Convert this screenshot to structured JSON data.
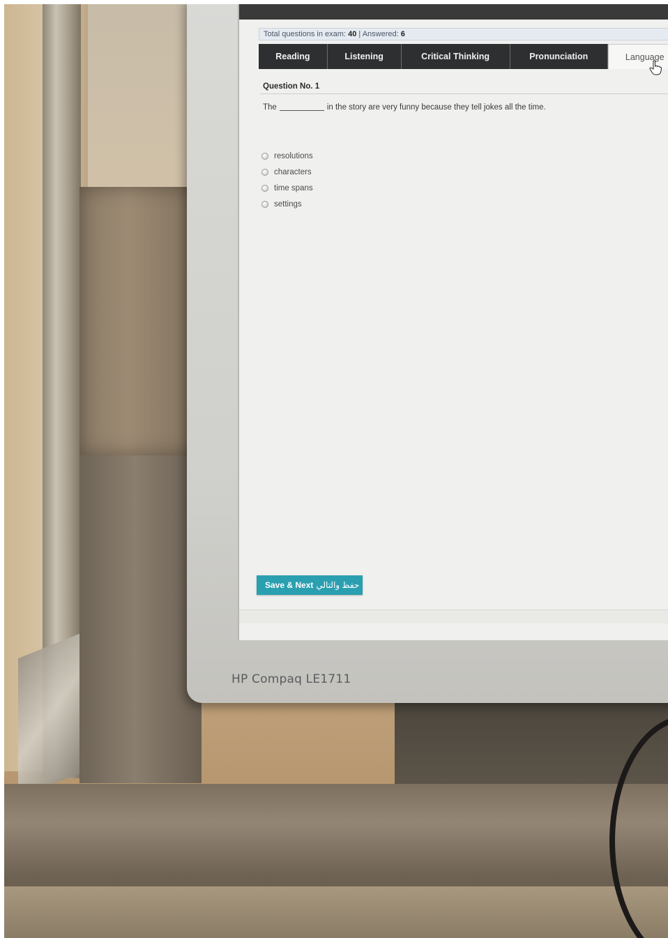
{
  "monitor": {
    "brand": "HP Compaq LE1711"
  },
  "exam": {
    "status": {
      "total_label": "Total questions in exam:",
      "total_value": "40",
      "answered_label": "| Answered:",
      "answered_value": "6"
    },
    "tabs": [
      {
        "label": "Reading"
      },
      {
        "label": "Listening"
      },
      {
        "label": "Critical Thinking"
      },
      {
        "label": "Pronunciation"
      },
      {
        "label": "Language"
      }
    ],
    "question": {
      "number_label": "Question No. 1",
      "text_before": "The",
      "text_after": "in the story are very funny because they tell jokes all the time."
    },
    "options": [
      {
        "label": "resolutions"
      },
      {
        "label": "characters"
      },
      {
        "label": "time spans"
      },
      {
        "label": "settings"
      }
    ],
    "save_button": {
      "label": "Save & Next",
      "label_ar": "حفظ والتالي"
    }
  },
  "colors": {
    "tab_bg": "#2e2f31",
    "button_accent": "#2a9fb0"
  }
}
